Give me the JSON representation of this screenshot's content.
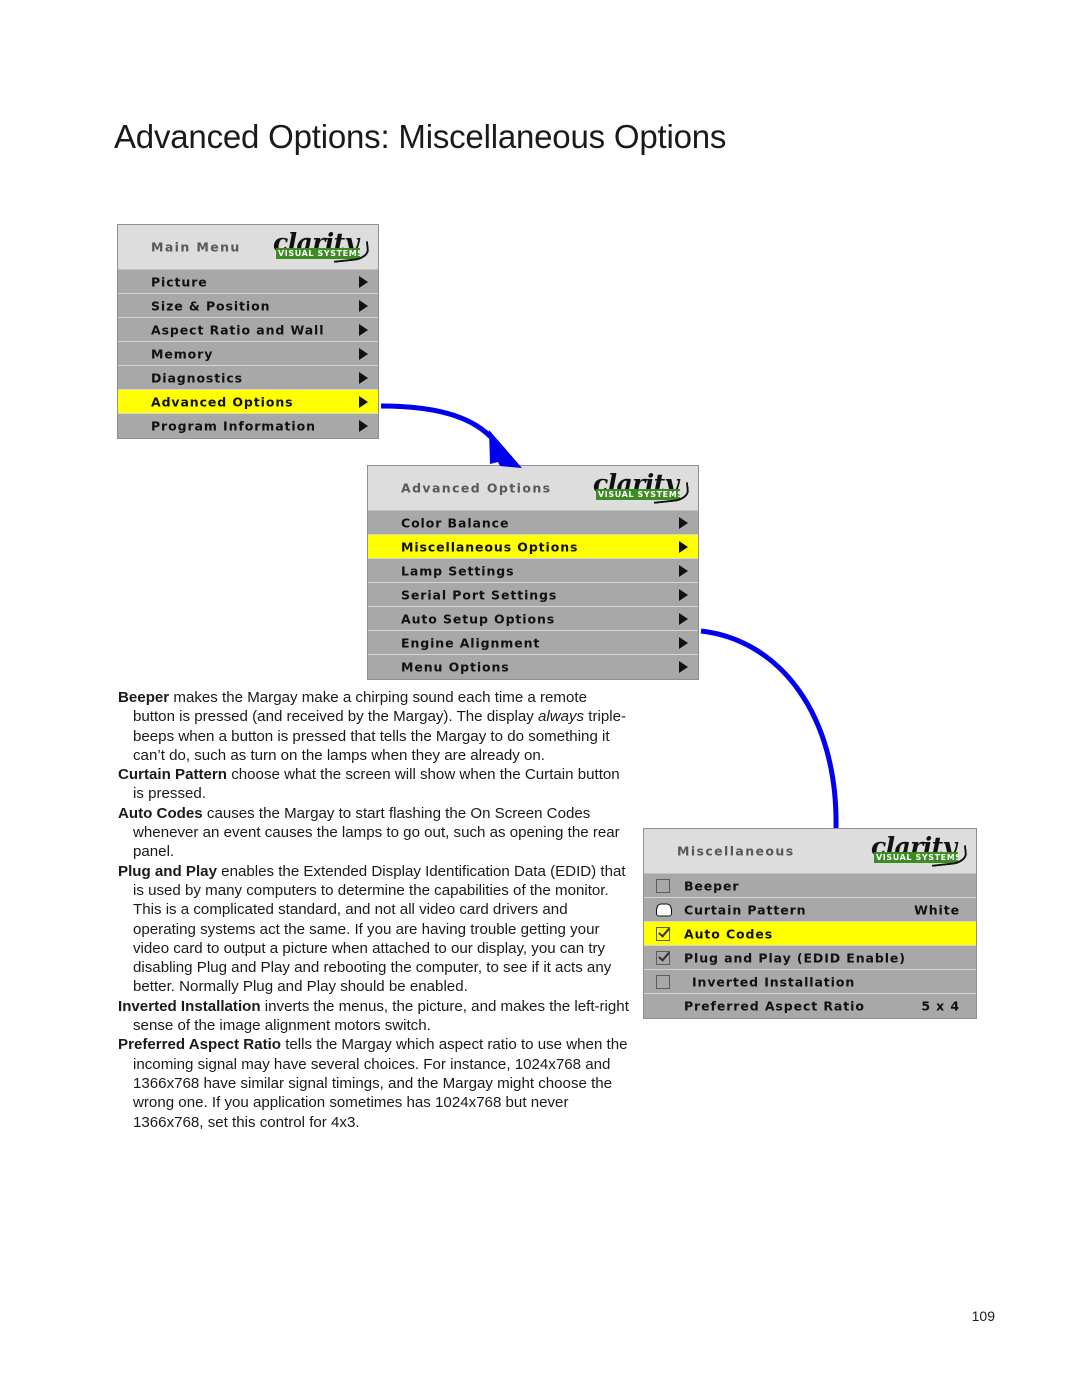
{
  "page": {
    "title": "Advanced Options: Miscellaneous Options",
    "number": "109"
  },
  "logo": {
    "word": "clarity",
    "tagline": "VISUAL SYSTEMS"
  },
  "colors": {
    "highlight": "#ffff00",
    "row": "#a8a8a8",
    "header": "#dddddd",
    "arrow": "#0000ee",
    "logo_band": "#3d8c23"
  },
  "panels": {
    "main_menu": {
      "header": "Main Menu",
      "rows": [
        {
          "label": "Picture",
          "caret": true,
          "highlight": false
        },
        {
          "label": "Size & Position",
          "caret": true,
          "highlight": false
        },
        {
          "label": "Aspect Ratio and Wall",
          "caret": true,
          "highlight": false
        },
        {
          "label": "Memory",
          "caret": true,
          "highlight": false
        },
        {
          "label": "Diagnostics",
          "caret": true,
          "highlight": false
        },
        {
          "label": "Advanced Options",
          "caret": true,
          "highlight": true
        },
        {
          "label": "Program Information",
          "caret": true,
          "highlight": false
        }
      ]
    },
    "advanced_options": {
      "header": "Advanced Options",
      "rows": [
        {
          "label": "Color Balance",
          "caret": true,
          "highlight": false
        },
        {
          "label": "Miscellaneous Options",
          "caret": true,
          "highlight": true
        },
        {
          "label": "Lamp Settings",
          "caret": true,
          "highlight": false
        },
        {
          "label": "Serial Port Settings",
          "caret": true,
          "highlight": false
        },
        {
          "label": "Auto Setup Options",
          "caret": true,
          "highlight": false
        },
        {
          "label": "Engine Alignment",
          "caret": true,
          "highlight": false
        },
        {
          "label": "Menu Options",
          "caret": true,
          "highlight": false
        }
      ]
    },
    "miscellaneous": {
      "header": "Miscellaneous",
      "rows": [
        {
          "label": "Beeper",
          "icon": "checkbox-unchecked",
          "value": "",
          "highlight": false
        },
        {
          "label": "Curtain Pattern",
          "icon": "screen-shape",
          "value": "White",
          "highlight": false
        },
        {
          "label": "Auto Codes",
          "icon": "checkbox-checked",
          "value": "",
          "highlight": true
        },
        {
          "label": "Plug and Play (EDID Enable)",
          "icon": "checkbox-checked",
          "value": "",
          "highlight": false
        },
        {
          "label": "Inverted Installation",
          "icon": "checkbox-unchecked",
          "value": "",
          "highlight": false
        },
        {
          "label": "Preferred Aspect Ratio",
          "icon": "none",
          "value": "5 x 4",
          "highlight": false
        }
      ]
    }
  },
  "body": {
    "paragraphs": [
      {
        "term": "Beeper",
        "html": "<b>Beeper</b> makes the Margay make a chirping sound each time a remote button is pressed (and received by the Margay). The display <i>always</i> triple-beeps when a button is pressed that tells the Margay to do something it can’t do, such as turn on the lamps when they are already on."
      },
      {
        "term": "Curtain Pattern",
        "html": "<b>Curtain Pattern</b> choose what the screen will show when the Curtain button is pressed."
      },
      {
        "term": "Auto Codes",
        "html": "<b>Auto Codes</b> causes the Margay to start flashing the On Screen Codes whenever an event causes the lamps to go out, such as opening the rear panel."
      },
      {
        "term": "Plug and Play",
        "html": "<b>Plug and Play</b> enables the Extended Display Identification Data (EDID) that is used by many computers to determine the capabilities of the monitor. This is a complicated standard, and not all video card drivers and operating systems act the same. If you are having trouble getting your video card to output a picture when attached to our display, you can try disabling Plug and Play and rebooting the computer, to see if it acts any better. Normally Plug and Play should be enabled."
      },
      {
        "term": "Inverted Installation",
        "html": "<b>Inverted Installation</b> inverts the menus, the picture, and makes the left-right sense of the image alignment motors switch."
      },
      {
        "term": "Preferred Aspect Ratio",
        "html": "<b>Preferred Aspect Ratio</b> tells the Margay which aspect ratio to use when the incoming signal may have several choices. For instance, 1024x768 and 1366x768 have similar signal timings, and the Margay might choose the wrong one. If you application sometimes has 1024x768 but never 1366x768, set this control for 4x3."
      }
    ]
  },
  "annotations": {
    "arrow_1": "main-menu-advanced-options-to-advanced-options-panel",
    "arrow_2": "advanced-options-miscellaneous-to-miscellaneous-panel"
  }
}
